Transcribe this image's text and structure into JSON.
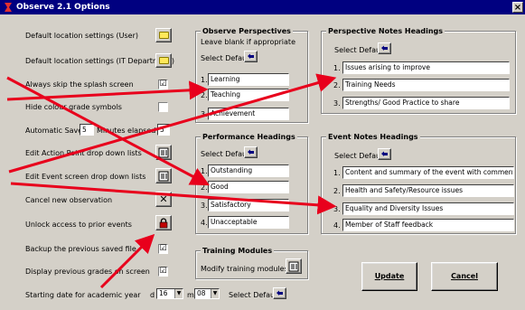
{
  "window": {
    "title": "Observe 2.1  Options",
    "close_glyph": "×"
  },
  "settings": {
    "default_location_user": "Default location settings (User)",
    "default_location_it": "Default location settings (IT Department)",
    "always_skip_splash": "Always skip the splash screen",
    "hide_colour_grade": "Hide colour grade symbols",
    "automatic_save_prefix": "Automatic Save",
    "automatic_save_suffix": "Minutes elapsed",
    "automatic_save_value": "5",
    "edit_action_point": "Edit Action Point drop down lists",
    "edit_event_screen": "Edit Event screen drop down lists",
    "cancel_new_observation": "Cancel new observation",
    "unlock_access": "Unlock access to prior events",
    "backup_previous": "Backup the previous saved file",
    "display_previous_grades": "Display previous grades on screen",
    "starting_date": "Starting date for academic year",
    "day_label": "d",
    "day_value": "16",
    "month_label": "m",
    "month_value": "08",
    "select_default": "Select Default",
    "check_mark": "☑",
    "cancel_glyph": "✕"
  },
  "observe_perspectives": {
    "title": "Observe Perspectives",
    "hint": "Leave blank if appropriate",
    "select_default": "Select Default",
    "items": [
      {
        "num": "1.",
        "value": "Learning"
      },
      {
        "num": "2.",
        "value": "Teaching"
      },
      {
        "num": "3.",
        "value": "Achievement"
      }
    ]
  },
  "perspective_notes": {
    "title": "Perspective Notes Headings",
    "select_default": "Select Default",
    "items": [
      {
        "num": "1.",
        "value": "Issues arising to improve"
      },
      {
        "num": "2.",
        "value": "Training Needs"
      },
      {
        "num": "3.",
        "value": "Strengths/ Good Practice to share"
      }
    ]
  },
  "performance_headings": {
    "title": "Performance Headings",
    "select_default": "Select Default",
    "items": [
      {
        "num": "1.",
        "value": "Outstanding"
      },
      {
        "num": "2.",
        "value": "Good"
      },
      {
        "num": "3.",
        "value": "Satisfactory"
      },
      {
        "num": "4.",
        "value": "Unacceptable"
      }
    ]
  },
  "event_notes": {
    "title": "Event Notes Headings",
    "select_default": "Select Default",
    "items": [
      {
        "num": "1.",
        "value": "Content and summary of the event with comment on a"
      },
      {
        "num": "2.",
        "value": "Health and Safety/Resource issues"
      },
      {
        "num": "3.",
        "value": "Equality and Diversity Issues"
      },
      {
        "num": "4.",
        "value": "Member of Staff feedback"
      }
    ]
  },
  "training_modules": {
    "title": "Training Modules",
    "modify_label": "Modify training modules"
  },
  "buttons": {
    "update": "Update",
    "cancel": "Cancel"
  },
  "colors": {
    "title_bar": "#000080",
    "annotation_arrow": "#e8001c",
    "face": "#d4d0c8"
  }
}
